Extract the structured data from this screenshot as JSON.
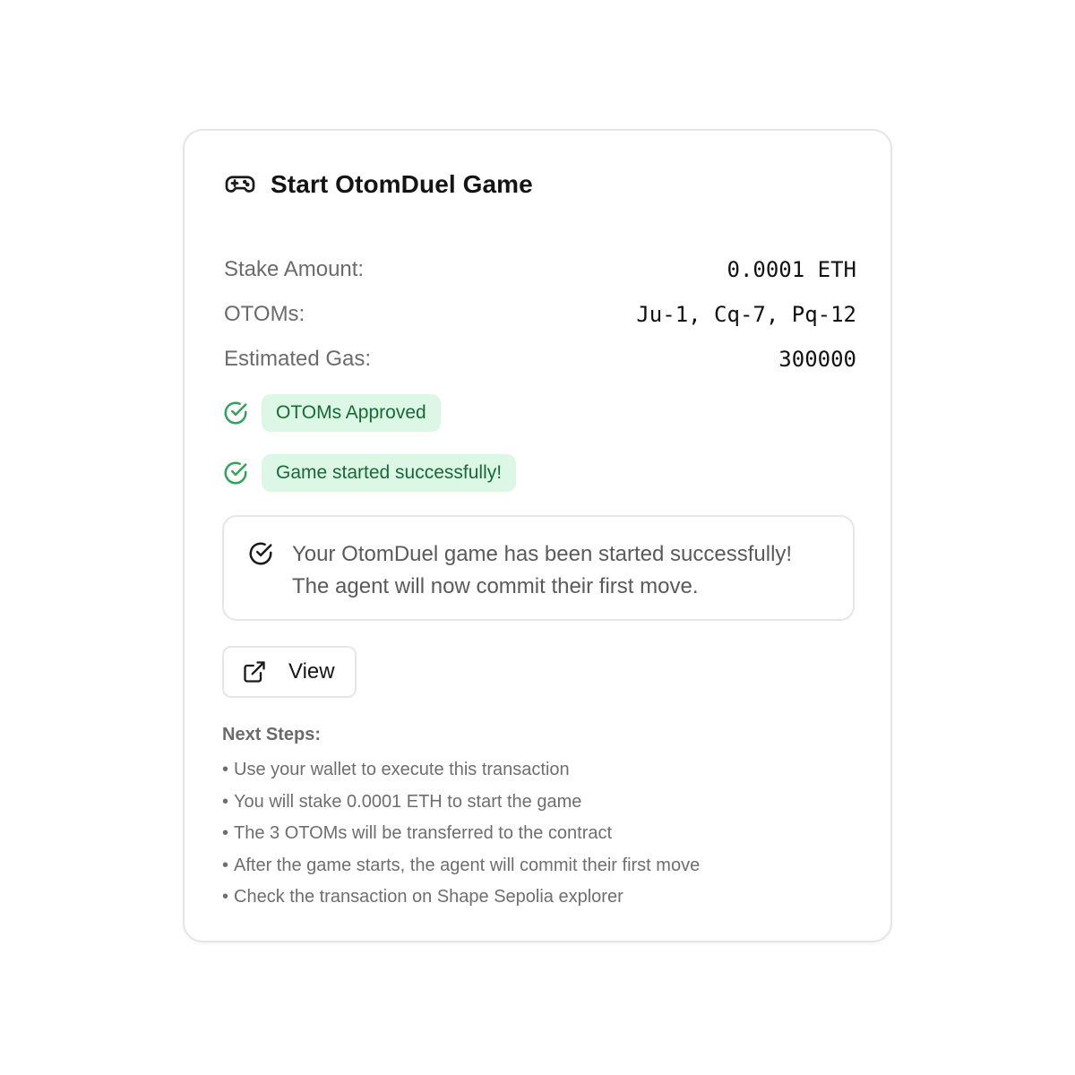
{
  "card": {
    "title": "Start OtomDuel Game",
    "title_icon": "gamepad-icon",
    "details": [
      {
        "label": "Stake Amount:",
        "value": "0.0001 ETH"
      },
      {
        "label": "OTOMs:",
        "value": "Ju-1, Cq-7, Pq-12"
      },
      {
        "label": "Estimated Gas:",
        "value": "300000"
      }
    ],
    "statuses": [
      {
        "icon": "check-circle-icon",
        "text": "OTOMs Approved"
      },
      {
        "icon": "check-circle-icon",
        "text": "Game started successfully!"
      }
    ],
    "message": {
      "icon": "check-circle-icon",
      "line1": "Your OtomDuel game has been started successfully!",
      "line2": "The agent will now commit their first move."
    },
    "view_button": {
      "icon": "external-link-icon",
      "label": "View"
    },
    "next_steps": {
      "heading": "Next Steps:",
      "items": [
        "Use your wallet to execute this transaction",
        "You will stake 0.0001 ETH to start the game",
        "The 3 OTOMs will be transferred to the contract",
        "After the game starts, the agent will commit their first move",
        "Check the transaction on Shape Sepolia explorer"
      ]
    },
    "colors": {
      "success_green": "#2fa35a",
      "badge_bg": "#dcf7e6",
      "badge_text": "#176a35"
    }
  }
}
